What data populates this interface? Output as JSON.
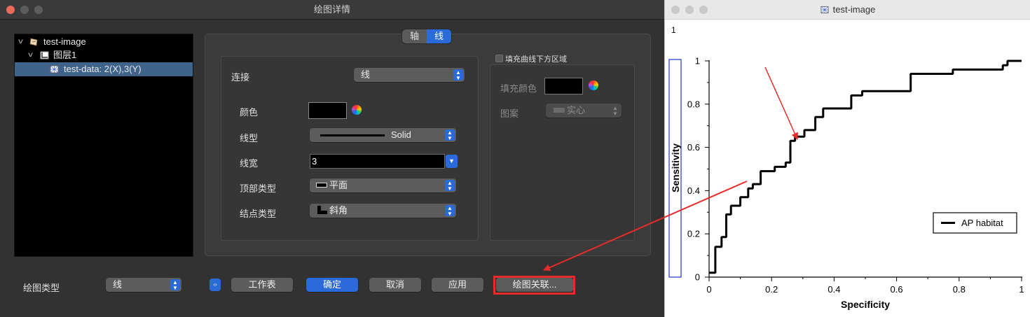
{
  "dialog": {
    "title": "绘图详情",
    "tree": [
      {
        "label": "test-image"
      },
      {
        "label": "图层1"
      },
      {
        "label": "test-data: 2(X),3(Y)"
      }
    ],
    "tabs": [
      "轴",
      "线"
    ],
    "active_tab": "线",
    "line": {
      "connect_label": "连接",
      "connect_value": "线",
      "color_label": "颜色",
      "color_value": "#000000",
      "linestyle_label": "线型",
      "linestyle_value": "Solid",
      "width_label": "线宽",
      "width_value": "3",
      "cap_label": "顶部类型",
      "cap_value": "平面",
      "join_label": "结点类型",
      "join_value": "斜角"
    },
    "fill": {
      "checkbox_label": "填充曲线下方区域",
      "color_label": "填充颜色",
      "color_value": "#000000",
      "pattern_label": "图案",
      "pattern_value": "实心"
    },
    "footer": {
      "plot_type_label": "绘图类型",
      "plot_type_value": "线",
      "worksheet": "工作表",
      "ok": "确定",
      "cancel": "取消",
      "apply": "应用",
      "associate": "绘图关联..."
    }
  },
  "plot_window": {
    "title": "test-image",
    "page_label": "1"
  },
  "chart_data": {
    "type": "line",
    "xlabel": "Specificity",
    "ylabel": "Sensitivity",
    "xlim": [
      0,
      1
    ],
    "ylim": [
      0,
      1
    ],
    "xticks": [
      0,
      0.2,
      0.4,
      0.6,
      0.8,
      1
    ],
    "yticks": [
      0,
      0.2,
      0.4,
      0.6,
      0.8,
      1
    ],
    "legend_position": "right",
    "series": [
      {
        "name": "AP habitat",
        "color": "#000000",
        "step": true,
        "x": [
          0,
          0.02,
          0.02,
          0.04,
          0.04,
          0.055,
          0.055,
          0.07,
          0.07,
          0.1,
          0.1,
          0.125,
          0.125,
          0.14,
          0.14,
          0.165,
          0.165,
          0.185,
          0.185,
          0.21,
          0.21,
          0.245,
          0.245,
          0.26,
          0.26,
          0.275,
          0.275,
          0.29,
          0.29,
          0.305,
          0.305,
          0.34,
          0.34,
          0.365,
          0.365,
          0.455,
          0.455,
          0.49,
          0.49,
          0.565,
          0.565,
          0.645,
          0.645,
          0.78,
          0.78,
          0.94,
          0.94,
          0.955,
          0.955,
          0.965,
          0.965,
          1
        ],
        "y": [
          0.02,
          0.02,
          0.14,
          0.14,
          0.185,
          0.185,
          0.29,
          0.29,
          0.33,
          0.33,
          0.37,
          0.37,
          0.41,
          0.41,
          0.43,
          0.43,
          0.49,
          0.49,
          0.49,
          0.49,
          0.51,
          0.51,
          0.53,
          0.53,
          0.63,
          0.63,
          0.65,
          0.65,
          0.65,
          0.65,
          0.68,
          0.68,
          0.74,
          0.74,
          0.78,
          0.78,
          0.84,
          0.84,
          0.86,
          0.86,
          0.86,
          0.86,
          0.94,
          0.94,
          0.96,
          0.96,
          0.98,
          0.98,
          1.0,
          1.0,
          1.0,
          1.0
        ]
      }
    ]
  }
}
